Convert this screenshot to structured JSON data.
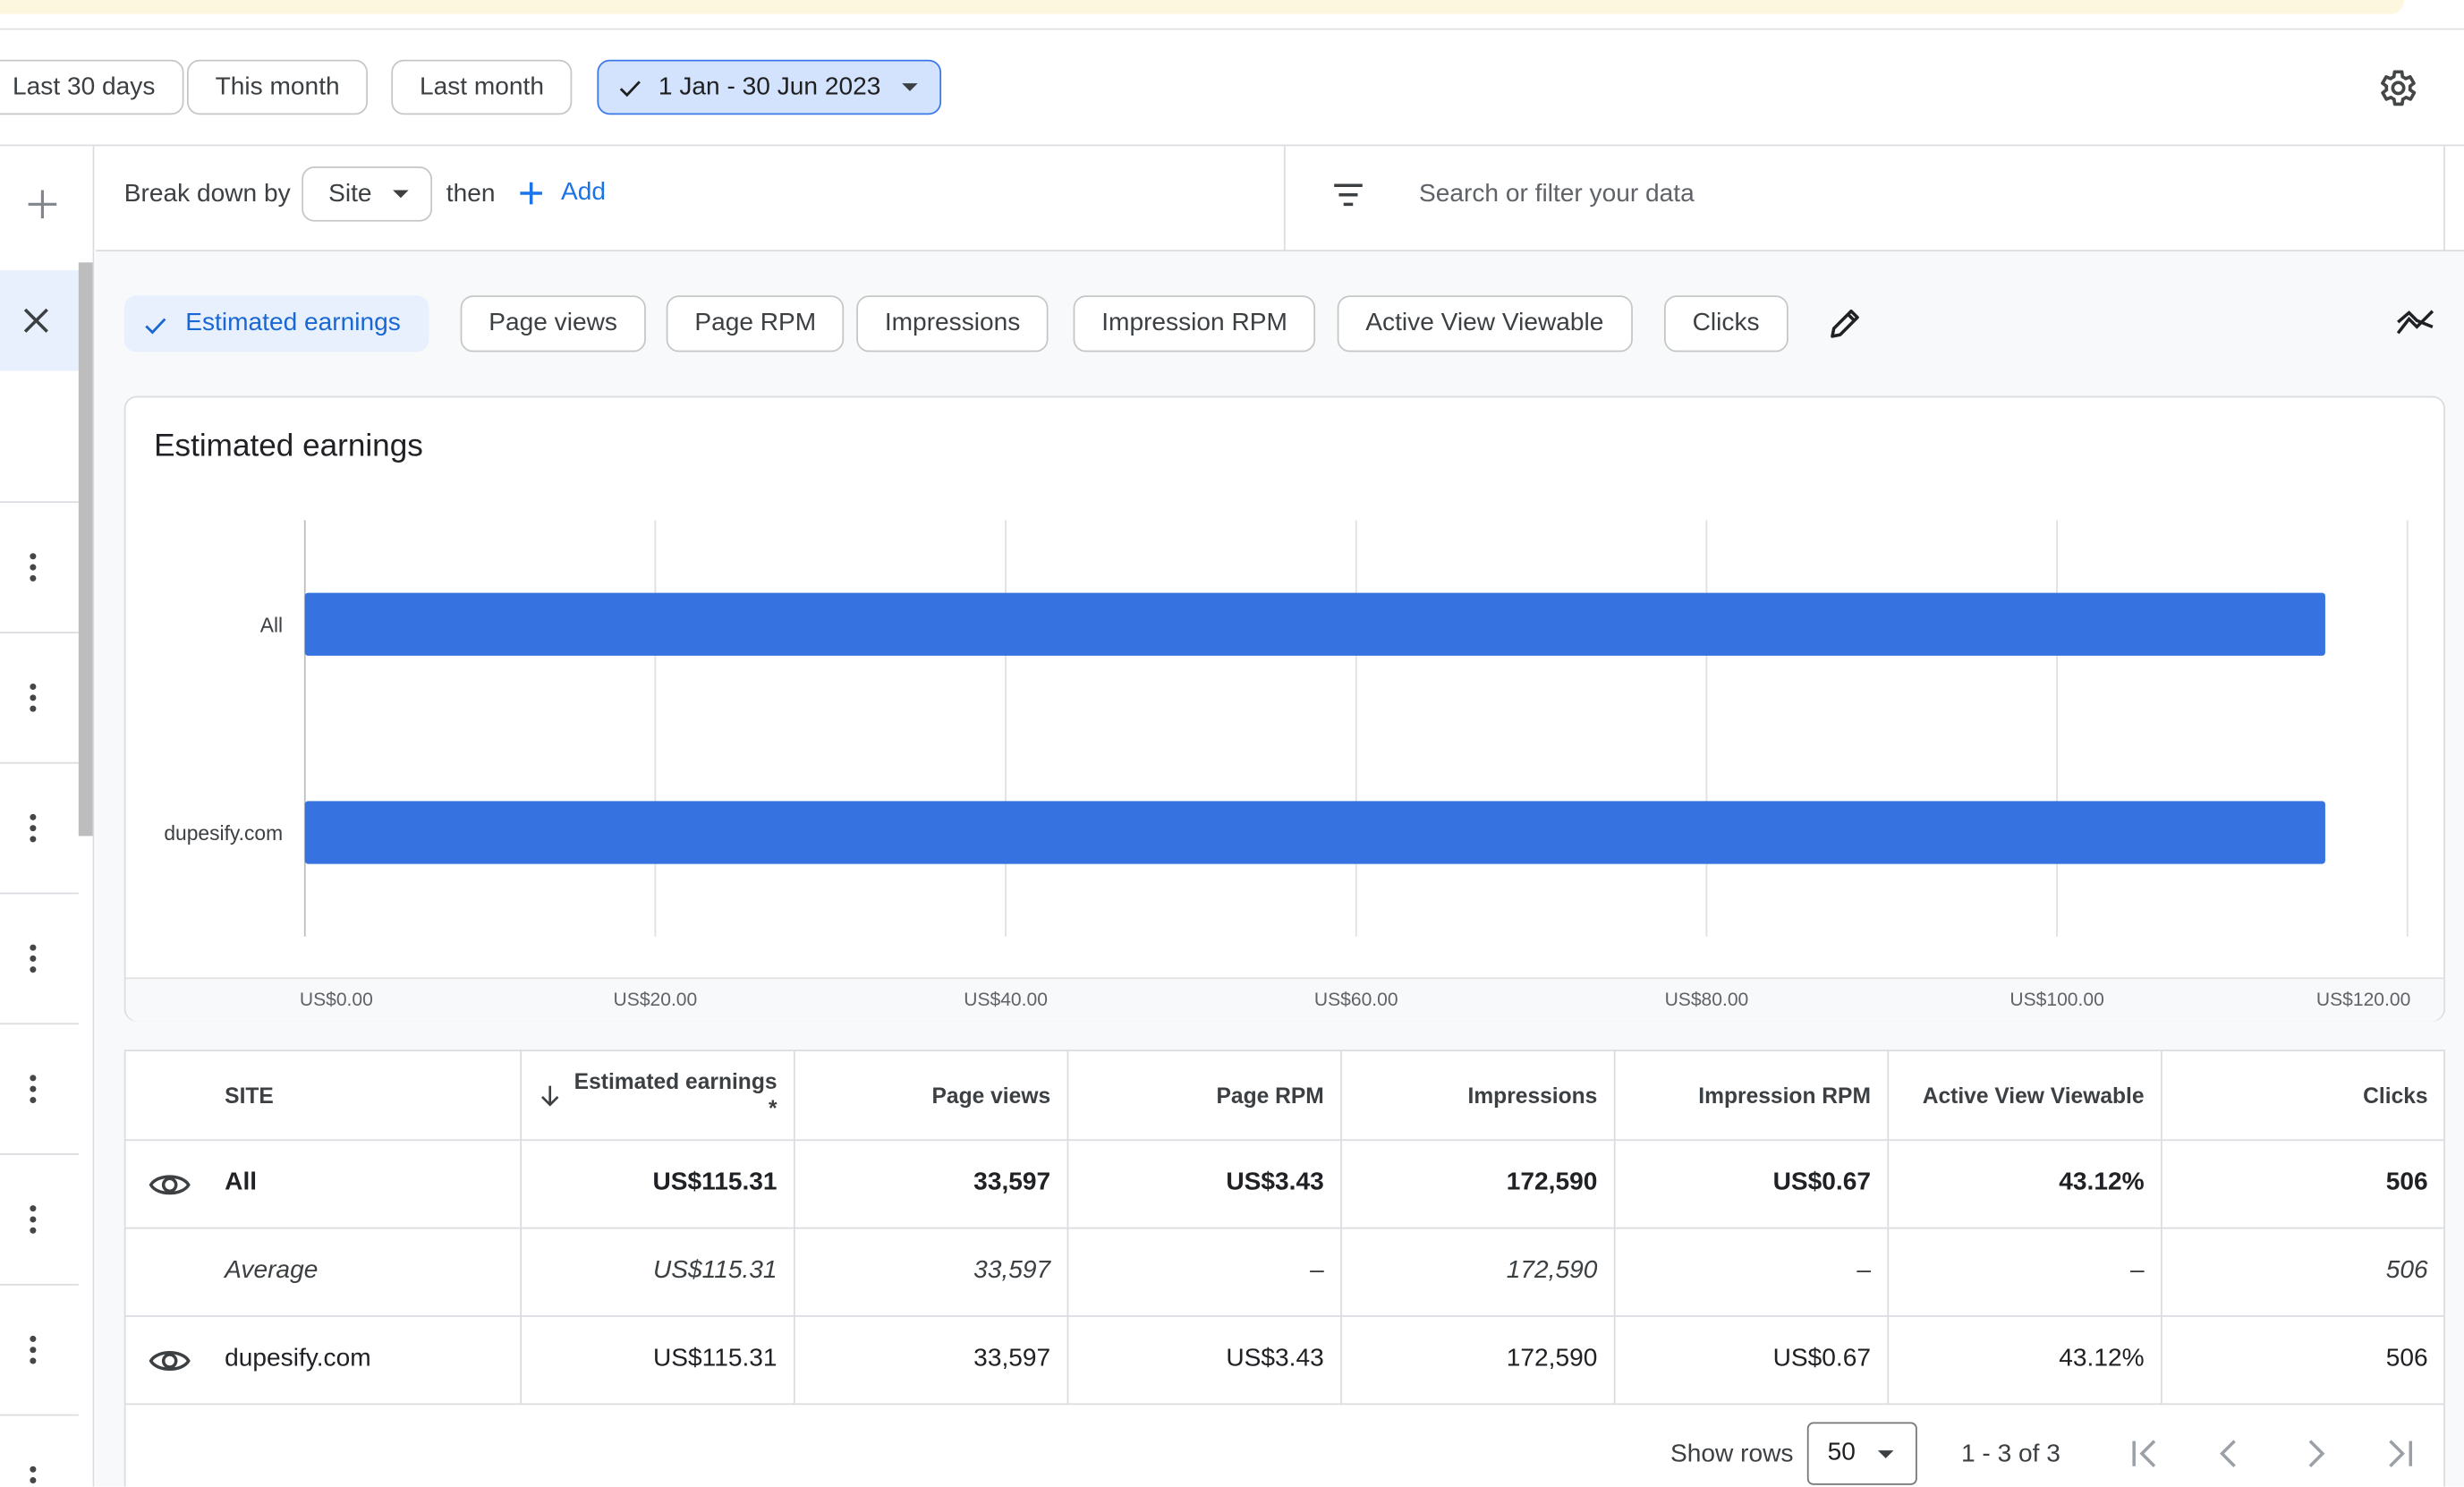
{
  "date_filters": {
    "chips": [
      "Last 30 days",
      "This month",
      "Last month"
    ],
    "selected": "1 Jan - 30 Jun 2023"
  },
  "toolbar": {
    "break_down_label": "Break down by",
    "site_select": "Site",
    "then_label": "then",
    "add_label": "Add",
    "search_placeholder": "Search or filter your data"
  },
  "metrics": {
    "active": "Estimated earnings",
    "chips": [
      "Page views",
      "Page RPM",
      "Impressions",
      "Impression RPM",
      "Active View Viewable",
      "Clicks"
    ]
  },
  "chart_data": {
    "type": "bar",
    "orientation": "horizontal",
    "title": "Estimated earnings",
    "categories": [
      "All",
      "dupesify.com"
    ],
    "values": [
      115.31,
      115.31
    ],
    "xlim": [
      0,
      120
    ],
    "x_ticks": [
      "US$0.00",
      "US$20.00",
      "US$40.00",
      "US$60.00",
      "US$80.00",
      "US$100.00",
      "US$120.00"
    ],
    "grid": true,
    "bar_color": "#3673e0"
  },
  "table": {
    "headers": {
      "site": "SITE",
      "earnings_line1": "Estimated earnings",
      "earnings_line2": "*",
      "page_views": "Page views",
      "page_rpm": "Page RPM",
      "impressions": "Impressions",
      "impression_rpm": "Impression RPM",
      "active_view": "Active View Viewable",
      "clicks": "Clicks"
    },
    "rows": [
      {
        "site": "All",
        "earnings": "US$115.31",
        "page_views": "33,597",
        "page_rpm": "US$3.43",
        "impressions": "172,590",
        "impression_rpm": "US$0.67",
        "active_view": "43.12%",
        "clicks": "506"
      },
      {
        "site": "Average",
        "earnings": "US$115.31",
        "page_views": "33,597",
        "page_rpm": "–",
        "impressions": "172,590",
        "impression_rpm": "–",
        "active_view": "–",
        "clicks": "506"
      },
      {
        "site": "dupesify.com",
        "earnings": "US$115.31",
        "page_views": "33,597",
        "page_rpm": "US$3.43",
        "impressions": "172,590",
        "impression_rpm": "US$0.67",
        "active_view": "43.12%",
        "clicks": "506"
      }
    ]
  },
  "pagination": {
    "show_rows_label": "Show rows",
    "rows_per_page": "50",
    "range": "1 - 3 of 3"
  }
}
